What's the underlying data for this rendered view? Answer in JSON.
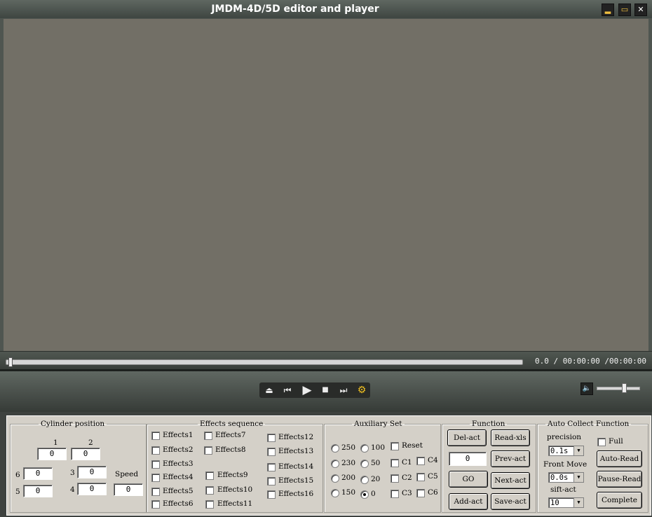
{
  "window": {
    "title": "JMDM-4D/5D editor and player",
    "minimize_glyph": "▂",
    "restore_glyph": "▭",
    "close_glyph": "✕"
  },
  "player": {
    "time_display": "0.0 / 00:00:00 /00:00:00",
    "progress": 0,
    "volume": 0.65,
    "controls": {
      "eject": "⏏",
      "prev": "⏮",
      "play": "▶",
      "stop": "■",
      "next": "⏭",
      "settings": "⚙",
      "volume": "🔈"
    }
  },
  "cylinder": {
    "legend": "Cylinder position",
    "col1": "1",
    "col2": "2",
    "v1": "0",
    "v2": "0",
    "l6": "6",
    "v6": "0",
    "l3": "3",
    "v3": "0",
    "l5": "5",
    "v5": "0",
    "l4": "4",
    "v4": "0",
    "speed_label": "Speed",
    "speed": "0"
  },
  "effects": {
    "legend": "Effects sequence",
    "items": [
      "Effects1",
      "Effects2",
      "Effects3",
      "Effects4",
      "Effects5",
      "Effects6",
      "Effects7",
      "Effects8",
      "Effects9",
      "Effects10",
      "Effects11",
      "Effects12",
      "Effects13",
      "Effects14",
      "Effects15",
      "Effects16"
    ]
  },
  "auxiliary": {
    "legend": "Auxiliary Set",
    "radios": [
      "250",
      "230",
      "200",
      "150",
      "100",
      "50",
      "20",
      "0"
    ],
    "selected": "0",
    "reset": "Reset",
    "c1": "C1",
    "c2": "C2",
    "c3": "C3",
    "c4": "C4",
    "c5": "C5",
    "c6": "C6"
  },
  "function": {
    "legend": "Function",
    "del_act": "Del-act",
    "read_xls": "Read-xls",
    "value": "0",
    "prev_act": "Prev-act",
    "go": "GO",
    "next_act": "Next-act",
    "add_act": "Add-act",
    "save_act": "Save-act"
  },
  "autocollect": {
    "legend": "Auto Collect Function",
    "precision_label": "precision",
    "precision_value": "0.1s",
    "full": "Full",
    "front_move_label": "Front Move",
    "front_move_value": "0.0s",
    "sift_label": "sift-act",
    "sift_value": "10",
    "auto_read": "Auto-Read",
    "pause_read": "Pause-Read",
    "complete": "Complete"
  },
  "colors": {
    "video_bg": "#726f66",
    "panel_bg": "#d4d0c8",
    "gear_accent": "#f0c020"
  }
}
